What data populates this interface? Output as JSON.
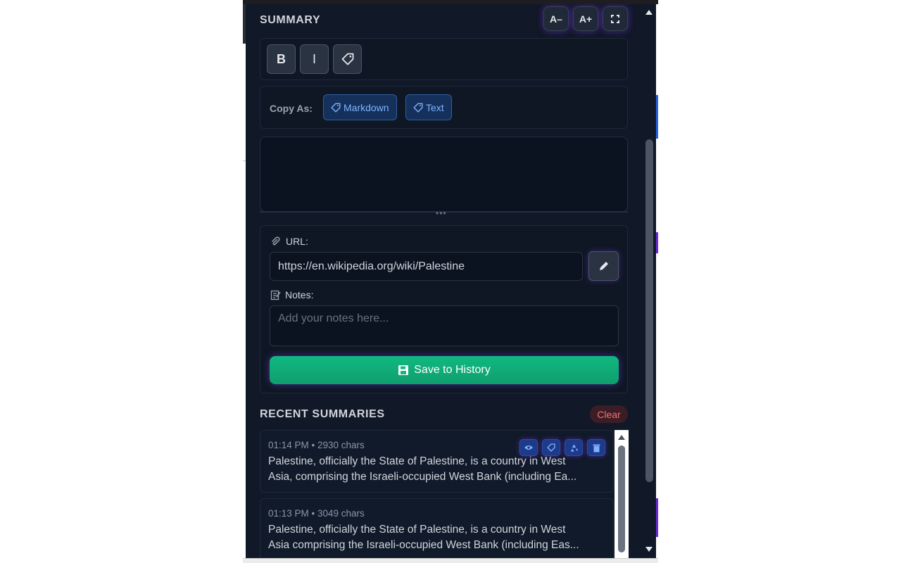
{
  "summary": {
    "title": "SUMMARY",
    "font_decrease_label": "A–",
    "font_increase_label": "A+",
    "expand_icon": "expand-icon"
  },
  "format_toolbar": {
    "bold_label": "B",
    "italic_label": "I",
    "tag_icon": "tag-icon"
  },
  "copy_as": {
    "label": "Copy As:",
    "markdown_label": "Markdown",
    "text_label": "Text"
  },
  "summary_text": {
    "value": ""
  },
  "url": {
    "label": "URL:",
    "value": "https://en.wikipedia.org/wiki/Palestine",
    "icon": "paperclip-icon",
    "edit_icon": "pencil-icon"
  },
  "notes": {
    "label": "Notes:",
    "placeholder": "Add your notes here...",
    "icon": "memo-icon"
  },
  "save": {
    "label": "Save to History",
    "icon": "floppy-icon"
  },
  "recent": {
    "title": "RECENT SUMMARIES",
    "clear_label": "Clear",
    "items": [
      {
        "meta": "01:14 PM • 2930 chars",
        "line1": "Palestine, officially the State of Palestine, is a country in West",
        "line2": "Asia, comprising the Israeli-occupied West Bank (including Ea..."
      },
      {
        "meta": "01:13 PM • 3049 chars",
        "line1": "Palestine, officially the State of Palestine, is a country in West",
        "line2": "Asia comprising the Israeli-occupied West Bank (including Eas..."
      }
    ],
    "item_action_icons": [
      "eye-icon",
      "tag-icon",
      "recycle-icon",
      "trash-icon"
    ]
  },
  "colors": {
    "panel_bg": "#111827",
    "accent_blue": "#7fb2ff",
    "save_green": "#10b981",
    "clear_red": "#f87171",
    "glow_purple": "#7c3aed"
  }
}
